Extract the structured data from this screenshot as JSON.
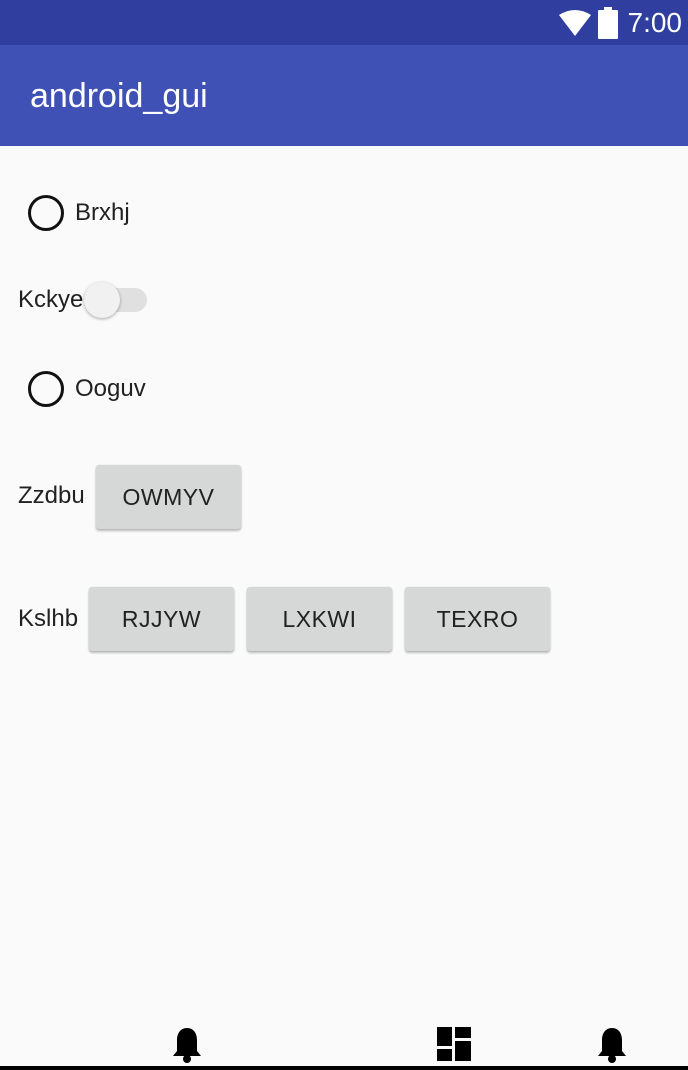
{
  "status_bar": {
    "time": "7:00",
    "icons": [
      "wifi-icon",
      "battery-icon"
    ],
    "color": "#303f9f"
  },
  "app_bar": {
    "title": "android_gui",
    "color": "#3f51b5"
  },
  "widgets": {
    "radio_1": {
      "label": "Brxhj",
      "checked": false
    },
    "switch_1": {
      "label": "Kckye",
      "on": false
    },
    "radio_2": {
      "label": "Ooguv",
      "checked": false
    },
    "row_zzdbu": {
      "label": "Zzdbu",
      "buttons": [
        "OWMYV"
      ]
    },
    "row_kslhb": {
      "label": "Kslhb",
      "buttons": [
        "RJJYW",
        "LXKWI",
        "TEXRO"
      ]
    }
  },
  "nav_bar": {
    "icons": [
      "bell-icon",
      "dashboard-icon",
      "bell-icon"
    ]
  }
}
